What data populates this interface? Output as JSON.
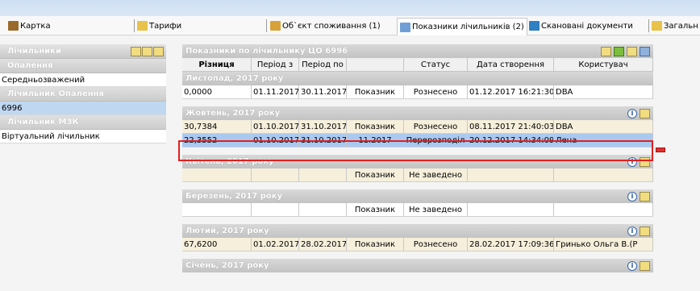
{
  "tabs": [
    {
      "label": "Картка"
    },
    {
      "label": "Тарифи"
    },
    {
      "label": "Об`єкт споживання (1)"
    },
    {
      "label": "Показники лічильників (2)"
    },
    {
      "label": "Сканованi документи"
    },
    {
      "label": "Загальн"
    }
  ],
  "left": {
    "title": "Лічильники",
    "section1": "Опалення",
    "section1_value": "Середньозважений",
    "section2": "Лічильник Опалення",
    "section2_value": "6996",
    "section3": "Лічильник МЗК",
    "section3_value": "Віртуальний лічильник"
  },
  "main": {
    "title": "Показники по лічильнику ЦО 6996",
    "columns": [
      "Різниця",
      "Період з",
      "Період по",
      "",
      "Статус",
      "Дата створення",
      "Користувач"
    ],
    "groups": [
      {
        "title": "Листопад, 2017 року",
        "rows": [
          {
            "diff": "0,0000",
            "from": "01.11.2017",
            "to": "30.11.2017",
            "type": "Показник",
            "status": "Рознесено",
            "created": "01.12.2017 16:21:30",
            "user": "DBA"
          }
        ]
      },
      {
        "title": "Жовтень, 2017 року",
        "rows": [
          {
            "diff": "30,7384",
            "from": "01.10.2017",
            "to": "31.10.2017",
            "type": "Показник",
            "status": "Рознесено",
            "created": "08.11.2017 21:40:03",
            "user": "DBA"
          },
          {
            "diff": "22,3552",
            "from": "01.10.2017",
            "to": "31.10.2017",
            "type": "11.2017",
            "status": "Перерозподіл",
            "created": "20.12.2017 14:34:09",
            "user": "Лена"
          }
        ]
      },
      {
        "title": "Квітень, 2017 року",
        "rows": [
          {
            "diff": "",
            "from": "",
            "to": "",
            "type": "Показник",
            "status": "Не заведено",
            "created": "",
            "user": ""
          }
        ]
      },
      {
        "title": "Березень, 2017 року",
        "rows": [
          {
            "diff": "",
            "from": "",
            "to": "",
            "type": "Показник",
            "status": "Не заведено",
            "created": "",
            "user": ""
          }
        ]
      },
      {
        "title": "Лютий, 2017 року",
        "rows": [
          {
            "diff": "67,6200",
            "from": "01.02.2017",
            "to": "28.02.2017",
            "type": "Показник",
            "status": "Рознесено",
            "created": "28.02.2017 17:09:36",
            "user": "Гринько Ольга В.(Р"
          }
        ]
      },
      {
        "title": "Січень, 2017 року",
        "rows": []
      }
    ]
  }
}
